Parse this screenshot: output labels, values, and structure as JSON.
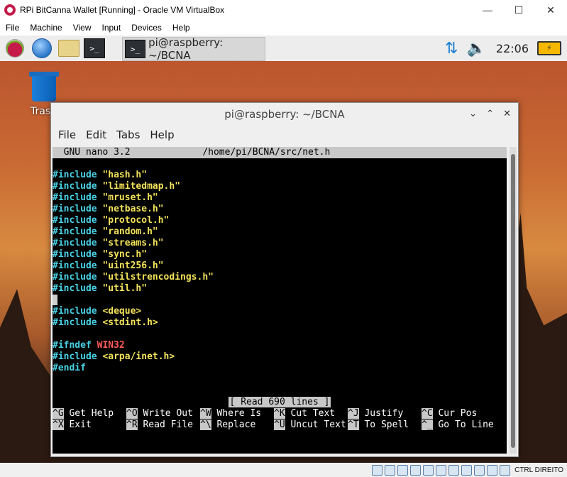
{
  "vbox": {
    "title": "RPi BitCanna Wallet [Running] - Oracle VM VirtualBox",
    "controls": {
      "minimize": "—",
      "maximize": "☐",
      "close": "✕"
    },
    "menu": [
      "File",
      "Machine",
      "View",
      "Input",
      "Devices",
      "Help"
    ],
    "host_key": "CTRL DIREITO"
  },
  "panel": {
    "task_label": "pi@raspberry: ~/BCNA",
    "clock": "22:06"
  },
  "desktop": {
    "trash_label": "Tras"
  },
  "terminal": {
    "title": "pi@raspberry: ~/BCNA",
    "menu": [
      "File",
      "Edit",
      "Tabs",
      "Help"
    ],
    "nano_header": "  GNU nano 3.2             /home/pi/BCNA/src/net.h",
    "includes_local": [
      "\"hash.h\"",
      "\"limitedmap.h\"",
      "\"mruset.h\"",
      "\"netbase.h\"",
      "\"protocol.h\"",
      "\"random.h\"",
      "\"streams.h\"",
      "\"sync.h\"",
      "\"uint256.h\"",
      "\"utilstrencodings.h\"",
      "\"util.h\""
    ],
    "include_kw": "#include",
    "includes_system": [
      "<deque>",
      "<stdint.h>"
    ],
    "ifndef_kw": "#ifndef",
    "ifndef_macro": "WIN32",
    "include_inet": "<arpa/inet.h>",
    "endif_kw": "#endif",
    "status": "[ Read 690 lines ]",
    "help_row1": [
      {
        "key": "^G",
        "label": " Get Help"
      },
      {
        "key": "^O",
        "label": " Write Out"
      },
      {
        "key": "^W",
        "label": " Where Is"
      },
      {
        "key": "^K",
        "label": " Cut Text"
      },
      {
        "key": "^J",
        "label": " Justify"
      },
      {
        "key": "^C",
        "label": " Cur Pos"
      }
    ],
    "help_row2": [
      {
        "key": "^X",
        "label": " Exit"
      },
      {
        "key": "^R",
        "label": " Read File"
      },
      {
        "key": "^\\",
        "label": " Replace"
      },
      {
        "key": "^U",
        "label": " Uncut Text"
      },
      {
        "key": "^T",
        "label": " To Spell"
      },
      {
        "key": "^_",
        "label": " Go To Line"
      }
    ]
  }
}
